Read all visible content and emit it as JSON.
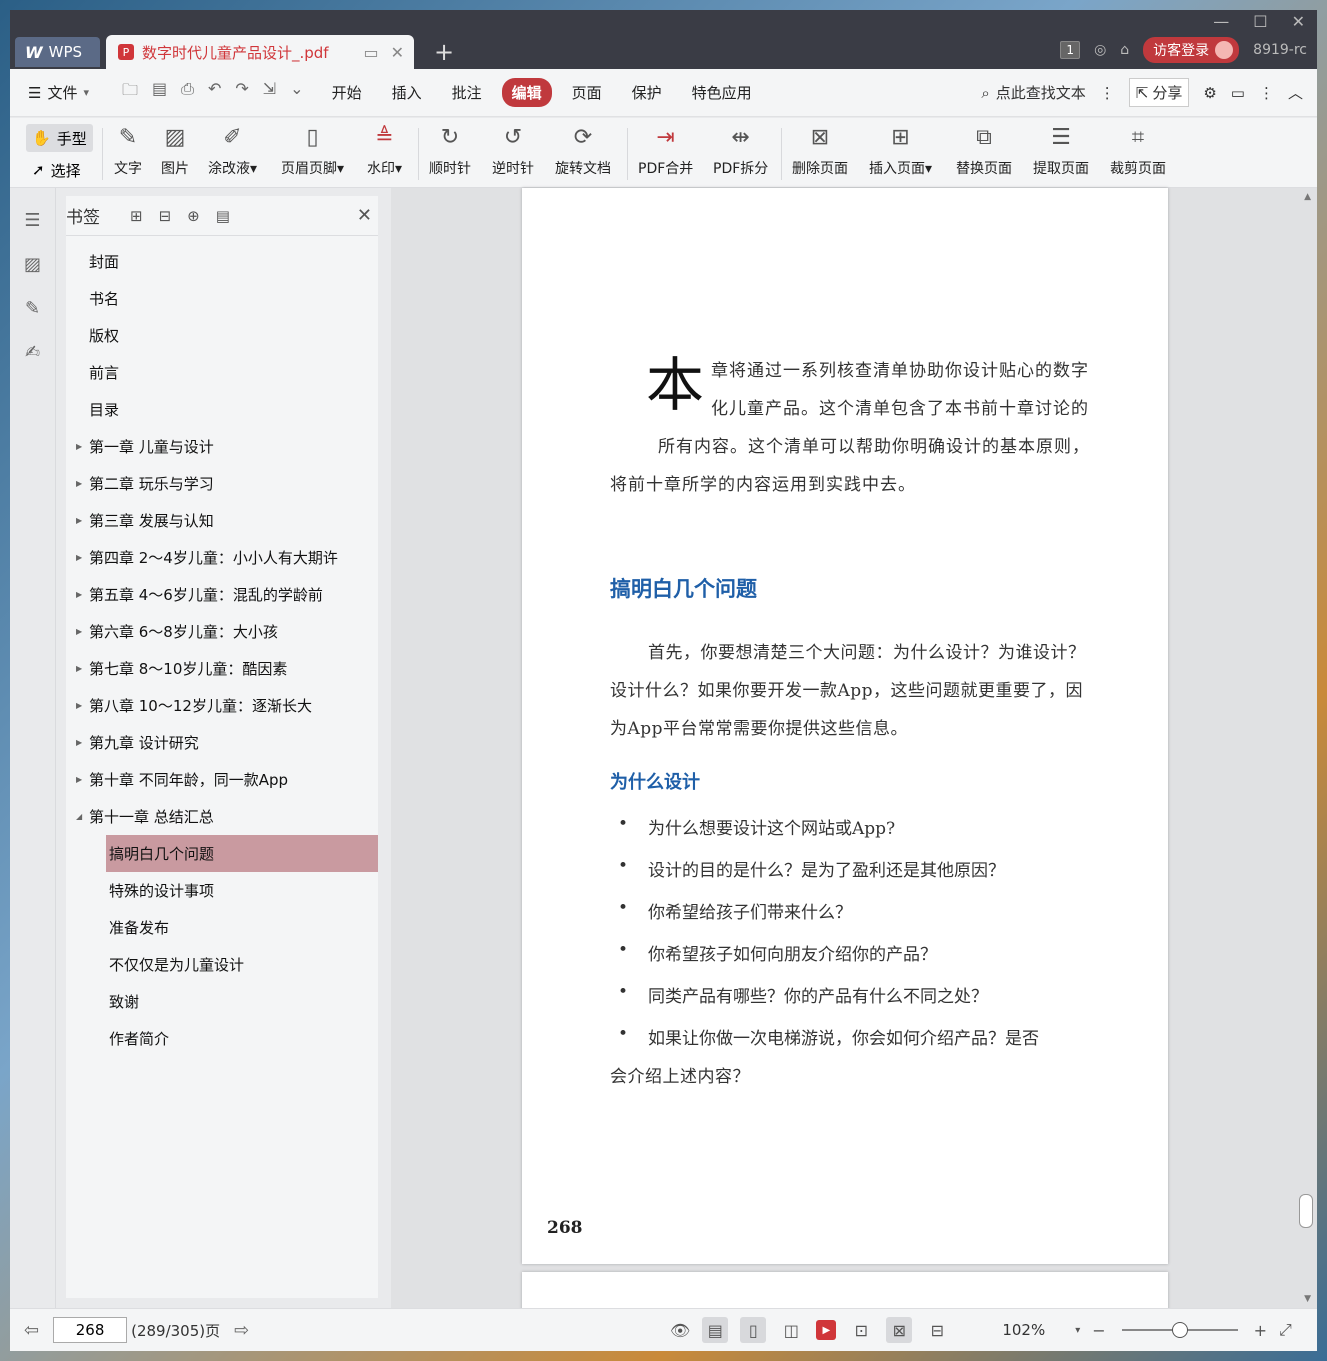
{
  "titlebar": {
    "app_tab": "WPS",
    "doc_tab": "数字时代儿童产品设计_.pdf",
    "page_badge": "1",
    "guest_login": "访客登录",
    "user_id": "8919-rc"
  },
  "menubar": {
    "file": "文件",
    "items": [
      "开始",
      "插入",
      "批注",
      "编辑",
      "页面",
      "保护",
      "特色应用"
    ],
    "active": "编辑",
    "search": "点此查找文本",
    "share": "分享"
  },
  "ribbon": {
    "hand": "手型",
    "select": "选择",
    "tools": {
      "text": "文字",
      "image": "图片",
      "whiteout": "涂改液",
      "header_footer": "页眉页脚",
      "watermark": "水印",
      "rotate_cw": "顺时针",
      "rotate_ccw": "逆时针",
      "rotate_doc": "旋转文档",
      "pdf_merge": "PDF合并",
      "pdf_split": "PDF拆分",
      "delete_page": "删除页面",
      "insert_page": "插入页面",
      "replace_page": "替换页面",
      "extract_page": "提取页面",
      "crop_page": "裁剪页面"
    }
  },
  "bookmarks": {
    "title": "书签",
    "items": [
      {
        "label": "封面"
      },
      {
        "label": "书名"
      },
      {
        "label": "版权"
      },
      {
        "label": "前言"
      },
      {
        "label": "目录"
      },
      {
        "label": "第一章  儿童与设计"
      },
      {
        "label": "第二章  玩乐与学习"
      },
      {
        "label": "第三章  发展与认知"
      },
      {
        "label": "第四章  2～4岁儿童：小小人有大期许"
      },
      {
        "label": "第五章  4～6岁儿童：混乱的学龄前"
      },
      {
        "label": "第六章  6～8岁儿童：大小孩"
      },
      {
        "label": "第七章  8～10岁儿童：酷因素"
      },
      {
        "label": "第八章  10～12岁儿童：逐渐长大"
      },
      {
        "label": "第九章  设计研究"
      },
      {
        "label": "第十章  不同年龄，同一款App"
      },
      {
        "label": "第十一章  总结汇总"
      },
      {
        "label": "搞明白几个问题"
      },
      {
        "label": "特殊的设计事项"
      },
      {
        "label": "准备发布"
      },
      {
        "label": "不仅仅是为儿童设计"
      },
      {
        "label": "致谢"
      },
      {
        "label": "作者简介"
      }
    ]
  },
  "page": {
    "dropcap": "本",
    "intro_lines": [
      "章将通过一系列核查清单协助你设计贴心的数字",
      "化儿童产品。这个清单包含了本书前十章讨论的",
      "所有内容。这个清单可以帮助你明确设计的基本原则，",
      "将前十章所学的内容运用到实践中去。"
    ],
    "heading": "搞明白几个问题",
    "body_lines": [
      "首先，你要想清楚三个大问题：为什么设计？为谁设计？",
      "设计什么？如果你要开发一款App，这些问题就更重要了，因",
      "为App平台常常需要你提供这些信息。"
    ],
    "subheading": "为什么设计",
    "bullets": [
      "为什么想要设计这个网站或App?",
      "设计的目的是什么？是为了盈利还是其他原因？",
      "你希望给孩子们带来什么？",
      "你希望孩子如何向朋友介绍你的产品？",
      "同类产品有哪些？你的产品有什么不同之处？",
      "如果让你做一次电梯游说，你会如何介绍产品？是否"
    ],
    "bullet_continuation": "会介绍上述内容？",
    "page_number": "268"
  },
  "statusbar": {
    "current_page": "268",
    "page_info": "(289/305)页",
    "zoom": "102%"
  }
}
